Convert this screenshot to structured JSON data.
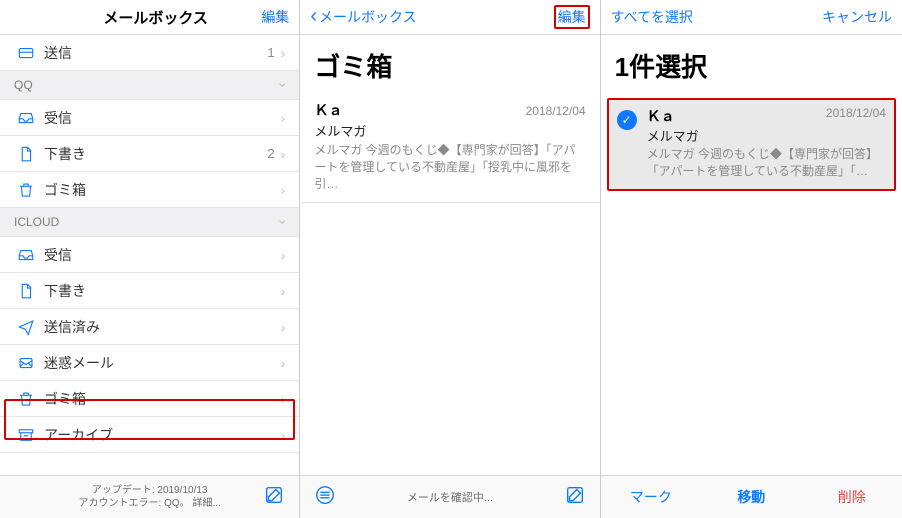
{
  "p1": {
    "title": "メールボックス",
    "edit": "編集",
    "sections": [
      "QQ",
      "ICLOUD"
    ],
    "folders_top": [
      {
        "icon": "outbox",
        "label": "送信",
        "count": "1"
      }
    ],
    "qq": [
      {
        "icon": "inbox",
        "label": "受信"
      },
      {
        "icon": "draft",
        "label": "下書き",
        "count": "2"
      },
      {
        "icon": "trash",
        "label": "ゴミ箱"
      }
    ],
    "icloud": [
      {
        "icon": "inbox",
        "label": "受信"
      },
      {
        "icon": "draft",
        "label": "下書き"
      },
      {
        "icon": "sent",
        "label": "送信済み"
      },
      {
        "icon": "junk",
        "label": "迷惑メール"
      },
      {
        "icon": "trash",
        "label": "ゴミ箱"
      },
      {
        "icon": "archive",
        "label": "アーカイブ"
      }
    ],
    "update_line1": "アップデート: 2019/10/13",
    "update_line2": "アカウントエラー: QQ。 詳細..."
  },
  "p2": {
    "back": "メールボックス",
    "edit": "編集",
    "title": "ゴミ箱",
    "msg": {
      "sender": "Ｋａ",
      "date": "2018/12/04",
      "subject": "メルマガ",
      "preview": "メルマガ 今週のもくじ◆【専門家が回答】「アパートを管理している不動産屋」「授乳中に風邪を引…"
    },
    "status": "メールを確認中..."
  },
  "p3": {
    "select_all": "すべてを選択",
    "cancel": "キャンセル",
    "title": "1件選択",
    "msg": {
      "sender": "Ｋａ",
      "date": "2018/12/04",
      "subject": "メルマガ",
      "preview": "メルマガ 今週のもくじ◆【専門家が回答】「アパートを管理している不動産屋」「…"
    },
    "mark": "マーク",
    "move": "移動",
    "delete": "削除"
  }
}
